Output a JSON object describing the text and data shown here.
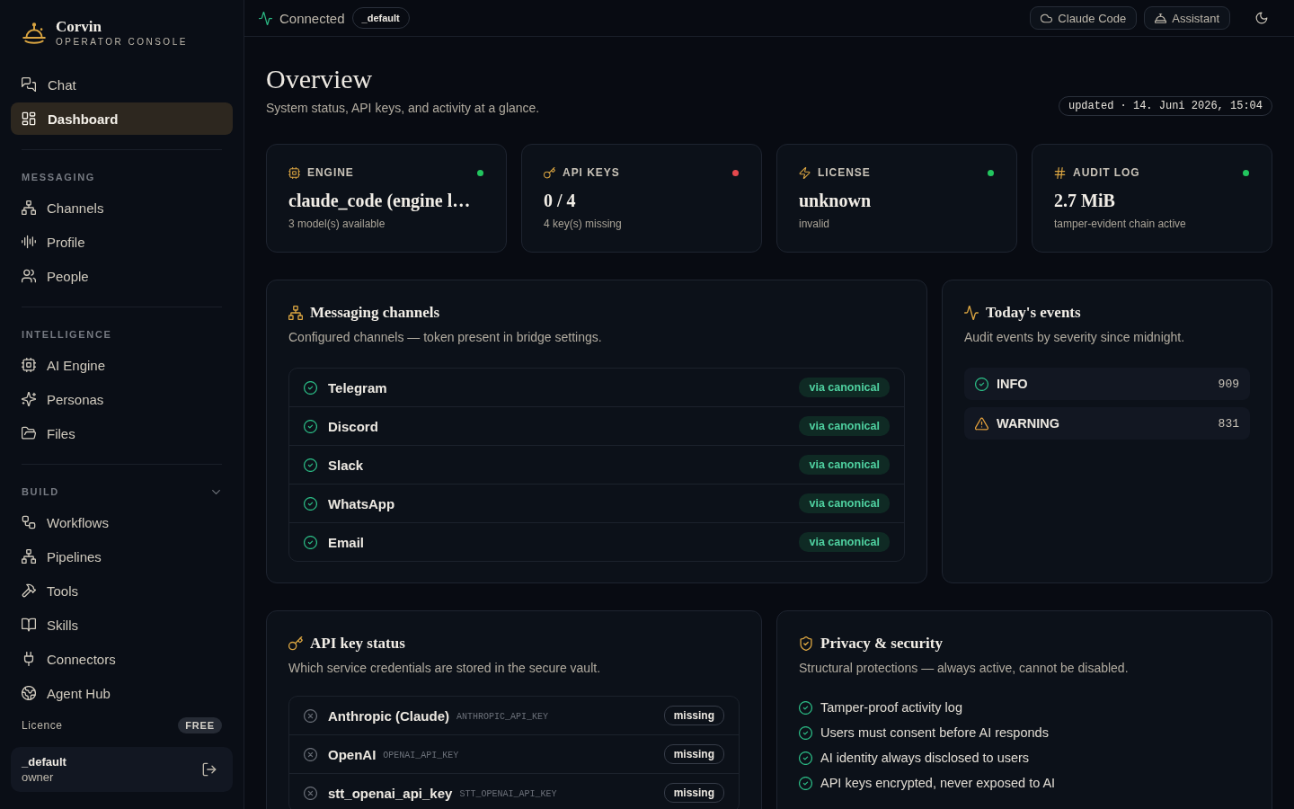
{
  "sidebar": {
    "brand": {
      "name": "Corvin",
      "tagline": "OPERATOR CONSOLE"
    },
    "nav": [
      {
        "label": "Chat",
        "selected": false
      },
      {
        "label": "Dashboard",
        "selected": true
      }
    ],
    "sections": [
      {
        "title": "MESSAGING",
        "kind": "group",
        "items": [
          {
            "label": "Channels",
            "selected": false
          },
          {
            "label": "Profile",
            "selected": false
          },
          {
            "label": "People",
            "selected": false
          }
        ]
      },
      {
        "title": "INTELLIGENCE",
        "kind": "group",
        "items": [
          {
            "label": "AI Engine",
            "selected": false
          },
          {
            "label": "Personas",
            "selected": false
          },
          {
            "label": "Files",
            "selected": false
          }
        ]
      },
      {
        "title": "BUILD",
        "kind": "collapsible",
        "expanded": true,
        "items": [
          {
            "label": "Workflows",
            "selected": false
          },
          {
            "label": "Pipelines",
            "selected": false
          },
          {
            "label": "Tools",
            "selected": false
          },
          {
            "label": "Skills",
            "selected": false
          },
          {
            "label": "Connectors",
            "selected": false
          },
          {
            "label": "Agent Hub",
            "selected": false
          }
        ]
      }
    ],
    "licence": {
      "label": "Licence",
      "plan": "FREE"
    },
    "user": {
      "name": "_default",
      "role": "owner"
    }
  },
  "topbar": {
    "status": "Connected",
    "workspace": "_default",
    "buttons": [
      "Claude Code",
      "Assistant"
    ]
  },
  "header": {
    "title": "Overview",
    "subtitle": "System status, API keys, and activity at a glance.",
    "updated": "updated · 14. Juni 2026, 15:04"
  },
  "stats": [
    {
      "label": "ENGINE",
      "value": "claude_code (engine l…",
      "detail": "3 model(s) available",
      "color": "#22c55e"
    },
    {
      "label": "API KEYS",
      "value": "0 / 4",
      "detail": "4 key(s) missing",
      "color": "#e5484d"
    },
    {
      "label": "LICENSE",
      "value": "unknown",
      "detail": "invalid",
      "color": "#22c55e"
    },
    {
      "label": "AUDIT LOG",
      "value": "2.7 MiB",
      "detail": "tamper-evident chain active",
      "color": "#22c55e"
    }
  ],
  "channels": {
    "title": "Messaging channels",
    "subtitle": "Configured channels — token present in bridge settings.",
    "items": [
      {
        "name": "Telegram",
        "source": "via canonical",
        "configured": true
      },
      {
        "name": "Discord",
        "source": "via canonical",
        "configured": true
      },
      {
        "name": "Slack",
        "source": "via canonical",
        "configured": true
      },
      {
        "name": "WhatsApp",
        "source": "via canonical",
        "configured": true
      },
      {
        "name": "Email",
        "source": "via canonical",
        "configured": true
      }
    ]
  },
  "events": {
    "title": "Today's events",
    "subtitle": "Audit events by severity since midnight.",
    "items": [
      {
        "kind": "info",
        "severity": "INFO",
        "count": "909"
      },
      {
        "kind": "warning",
        "severity": "WARNING",
        "count": "831"
      }
    ]
  },
  "api_keys": {
    "title": "API key status",
    "subtitle": "Which service credentials are stored in the secure vault.",
    "items": [
      {
        "name": "Anthropic (Claude)",
        "env": "ANTHROPIC_API_KEY",
        "status": "missing",
        "stored": false
      },
      {
        "name": "OpenAI",
        "env": "OPENAI_API_KEY",
        "status": "missing",
        "stored": false
      },
      {
        "name": "stt_openai_api_key",
        "env": "STT_OPENAI_API_KEY",
        "status": "missing",
        "stored": false
      }
    ]
  },
  "privacy": {
    "title": "Privacy & security",
    "subtitle": "Structural protections — always active, cannot be disabled.",
    "items": [
      "Tamper-proof activity log",
      "Users must consent before AI responds",
      "AI identity always disclosed to users",
      "API keys encrypted, never exposed to AI"
    ]
  }
}
